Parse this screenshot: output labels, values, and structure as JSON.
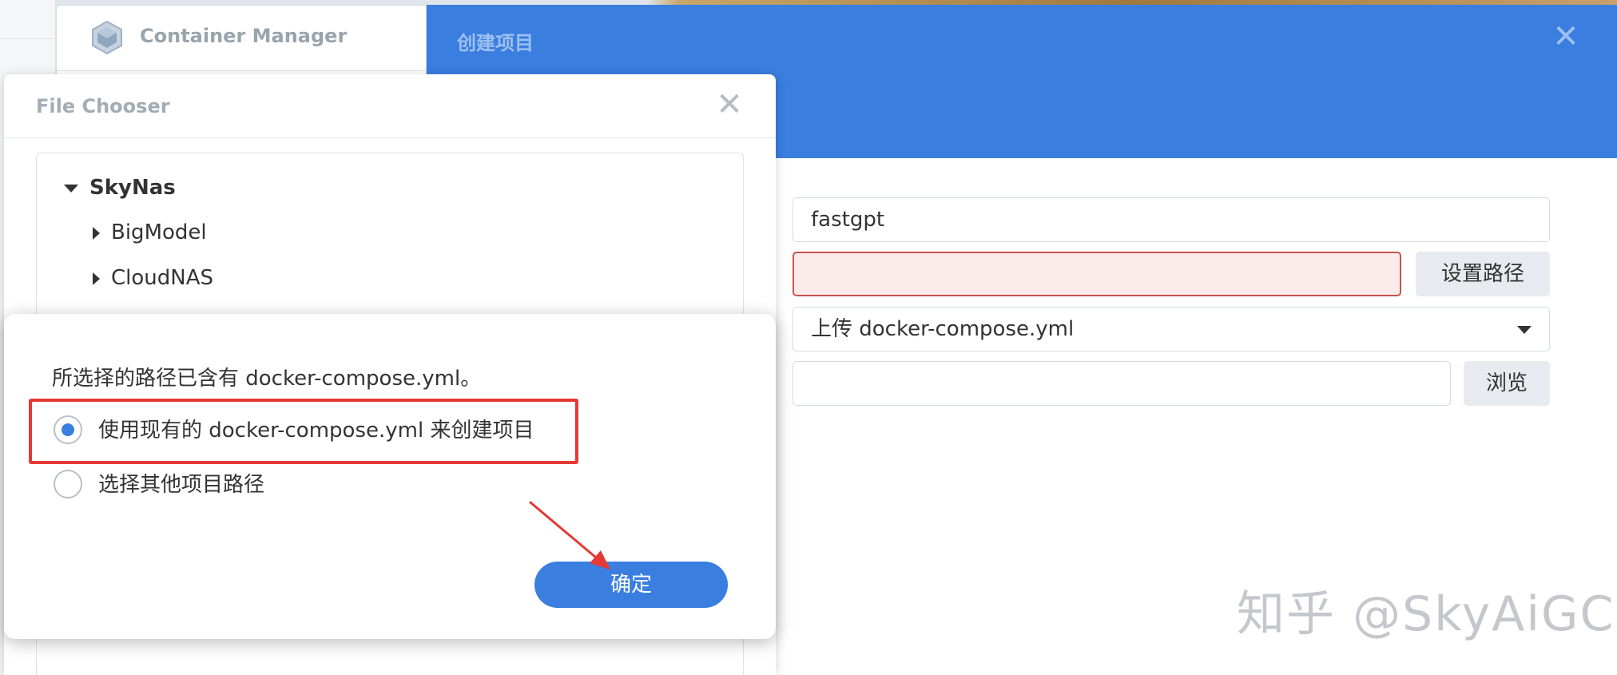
{
  "container_manager": {
    "title": "Container Manager",
    "icon": "container-manager-icon"
  },
  "create_project": {
    "title": "创建项目",
    "close_icon": "close-icon",
    "project_name_value": "fastgpt",
    "path_value": "",
    "set_path_button": "设置路径",
    "source_select_value": "上传 docker-compose.yml",
    "upload_file_value": "",
    "browse_button": "浏览"
  },
  "file_chooser": {
    "title": "File Chooser",
    "close_icon": "close-icon",
    "tree": {
      "root": "SkyNas",
      "children": [
        "BigModel",
        "CloudNAS"
      ]
    }
  },
  "dialog": {
    "message": "所选择的路径已含有 docker-compose.yml。",
    "options": [
      {
        "label": "使用现有的 docker-compose.yml 来创建项目",
        "checked": true
      },
      {
        "label": "选择其他项目路径",
        "checked": false
      }
    ],
    "confirm_button": "确定"
  },
  "watermark": "知乎 @SkyAiGC",
  "colors": {
    "accent": "#3a7ee0",
    "error_border": "#c9534c",
    "error_bg": "#fbeceb",
    "annotation_red": "#e53935"
  }
}
